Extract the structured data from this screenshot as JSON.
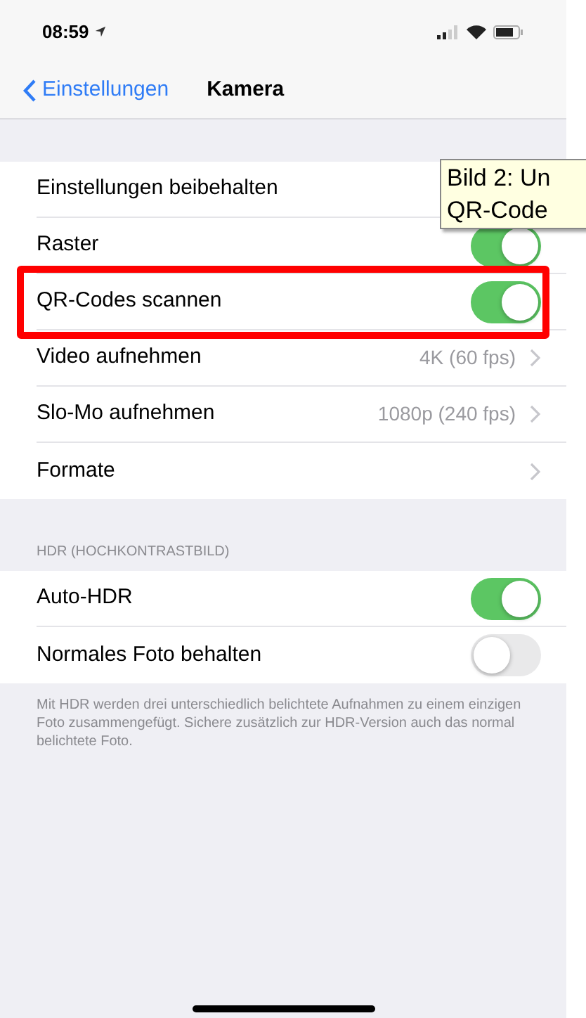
{
  "status_bar": {
    "time": "08:59"
  },
  "nav": {
    "back": "Einstellungen",
    "title": "Kamera"
  },
  "rows": [
    {
      "kind": "plain",
      "label": "Einstellungen beibehalten",
      "highlighted": false
    },
    {
      "kind": "toggle",
      "label": "Raster",
      "on": true,
      "highlighted": false
    },
    {
      "kind": "toggle",
      "label": "QR-Codes scannen",
      "on": true,
      "highlighted": true
    },
    {
      "kind": "link",
      "label": "Video aufnehmen",
      "value": "4K (60 fps)",
      "highlighted": false
    },
    {
      "kind": "link",
      "label": "Slo-Mo aufnehmen",
      "value": "1080p (240 fps)",
      "highlighted": false
    },
    {
      "kind": "link",
      "label": "Formate",
      "highlighted": false
    }
  ],
  "hdr": {
    "header": "HDR (HOCHKONTRASTBILD)",
    "rows": [
      {
        "kind": "toggle",
        "label": "Auto-HDR",
        "on": true,
        "highlighted": false
      },
      {
        "kind": "toggle",
        "label": "Normales Foto behalten",
        "on": false,
        "highlighted": false
      }
    ],
    "footer": "Mit HDR werden drei unterschiedlich belichtete Aufnahmen zu einem einzigen Foto zusammengefügt. Sichere zusätzlich zur HDR-Version auch das normal belichtete Foto."
  },
  "tooltip": {
    "lines": [
      "Bild 2: Un",
      "QR-Code"
    ]
  }
}
